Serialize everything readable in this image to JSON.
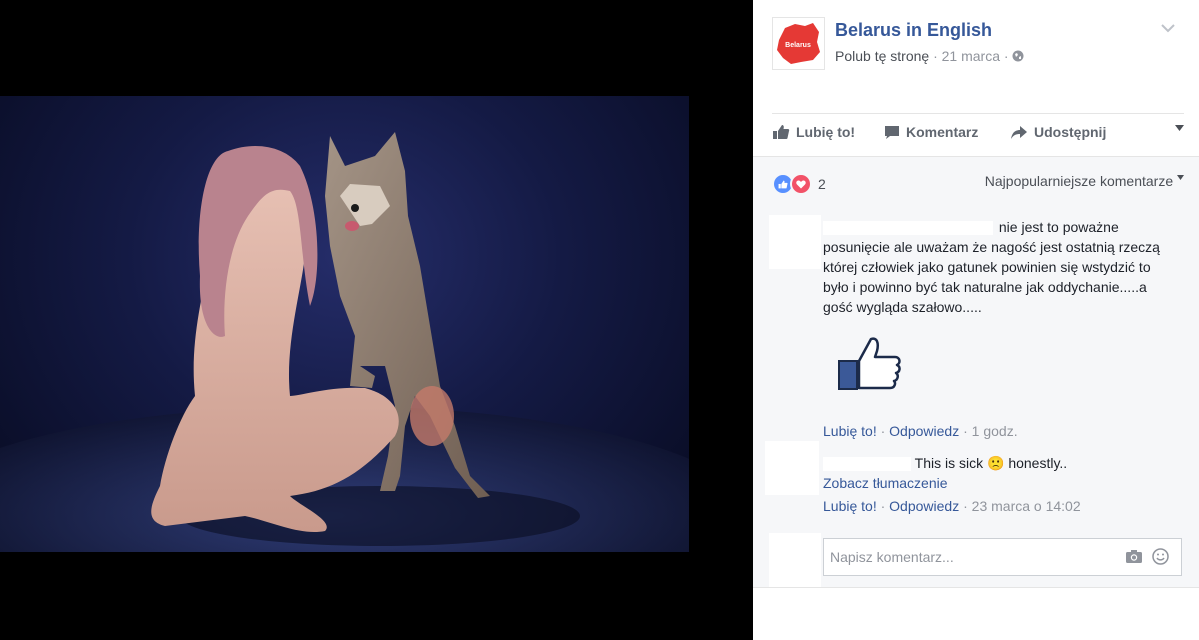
{
  "page": {
    "name": "Belarus in English",
    "avatar_label": "Belarus",
    "like_link": "Polub tę stronę",
    "separator": "·",
    "date": "21 marca",
    "privacy_icon": "globe-icon"
  },
  "actions": {
    "like": "Lubię to!",
    "comment": "Komentarz",
    "share": "Udostępnij"
  },
  "reactions": {
    "count": "2",
    "types": [
      "like",
      "love"
    ],
    "sort_label": "Najpopularniejsze komentarze"
  },
  "comments": [
    {
      "text": "nie jest to poważne posunięcie ale uważam że nagość jest ostatnią rzeczą której człowiek jako gatunek powinien się wstydzić to było i powinno być tak naturalne jak oddychanie.....a gość wygląda szałowo.....",
      "sticker": "thumbs-up",
      "like": "Lubię to!",
      "reply": "Odpowiedz",
      "time": "1 godz."
    },
    {
      "text_before": "This is sick",
      "emoji": "🙁",
      "text_after": "honestly..",
      "translation": "Zobacz tłumaczenie",
      "like": "Lubię to!",
      "reply": "Odpowiedz",
      "time": "23 marca o 14:02"
    }
  ],
  "composer": {
    "placeholder": "Napisz komentarz..."
  },
  "colors": {
    "link": "#365899",
    "meta": "#90949c",
    "like_reaction": "#5890ff",
    "love_reaction": "#f25268",
    "brand_red": "#e53935"
  }
}
